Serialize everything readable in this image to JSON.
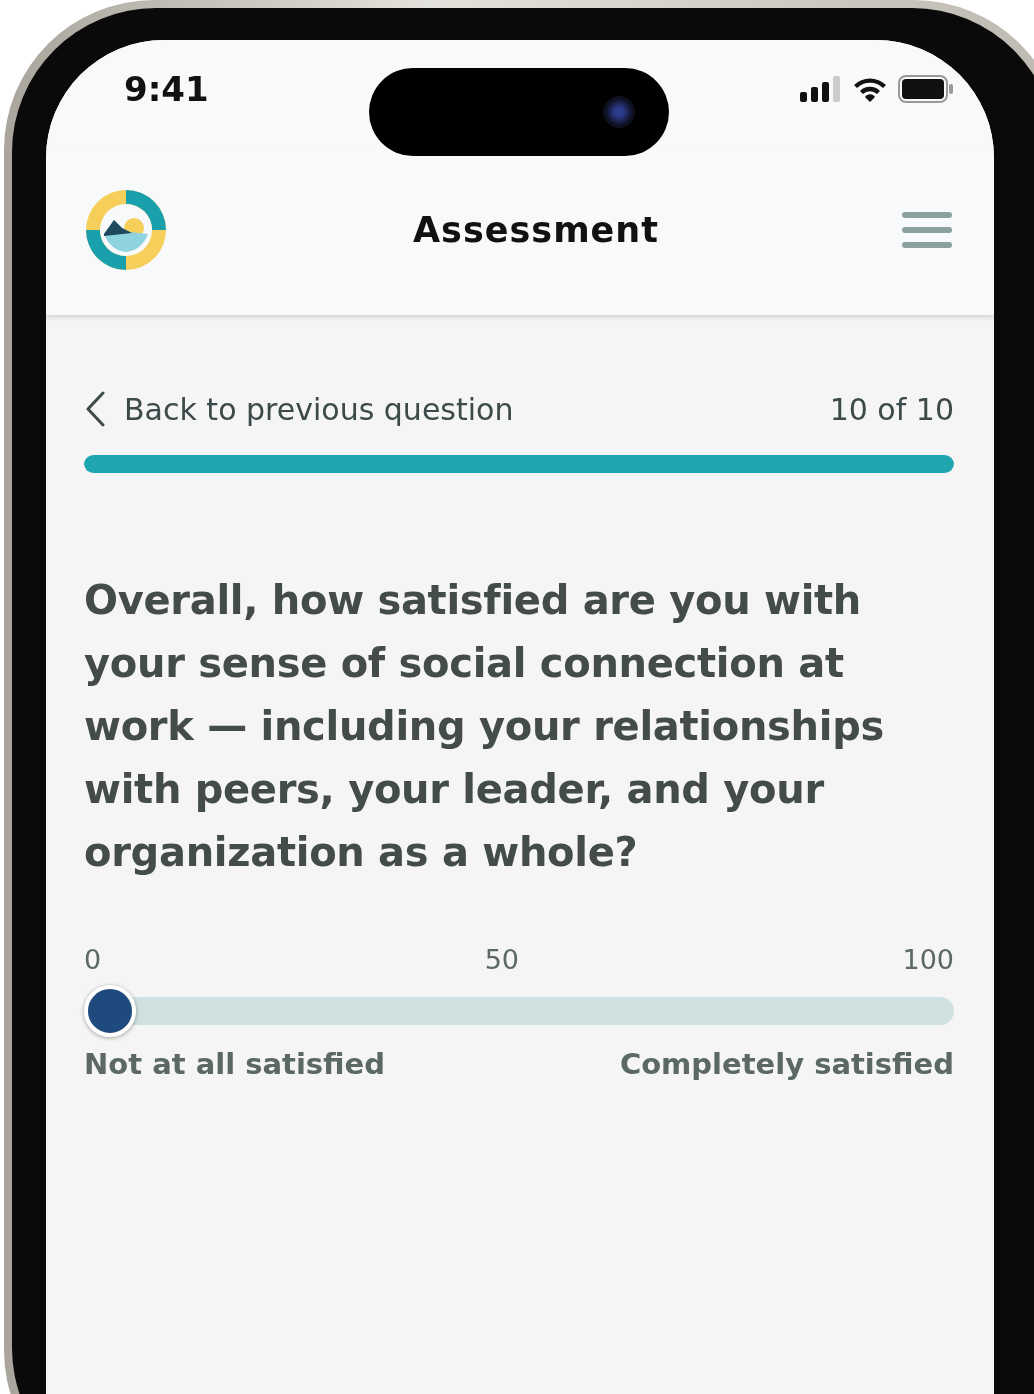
{
  "status_bar": {
    "time": "9:41"
  },
  "header": {
    "title": "Assessment"
  },
  "navigation": {
    "back_label": "Back to previous question",
    "counter": "10 of 10"
  },
  "progress": {
    "level": 1
  },
  "question": {
    "text": "Overall, how satisfied are you with your sense of social connection at work — including your relationships with peers, your leader, and your organization as a whole?"
  },
  "slider": {
    "ticks": [
      "0",
      "50",
      "100"
    ],
    "level": 0,
    "min_label": "Not at all satisfied",
    "max_label": "Completely satisfied"
  }
}
